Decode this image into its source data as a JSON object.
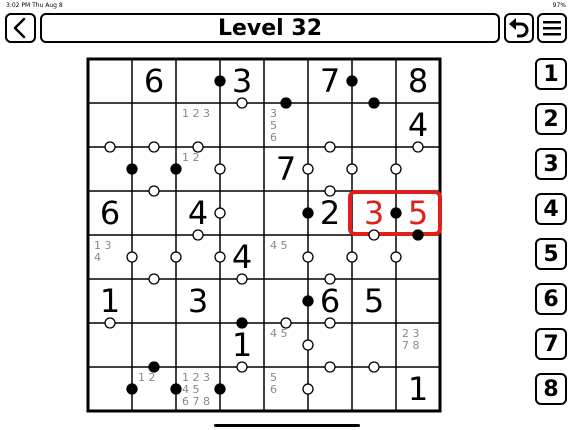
{
  "status_bar": {
    "time": "3:02 PM  Thu Aug 8",
    "battery": "97%"
  },
  "header": {
    "title": "Level 32"
  },
  "icons": {
    "back": "chevron-left-icon",
    "undo": "undo-icon",
    "menu": "hamburger-menu-icon"
  },
  "number_pad": [
    "1",
    "2",
    "3",
    "4",
    "5",
    "6",
    "7",
    "8"
  ],
  "colors": {
    "highlight": "#e0201c",
    "grid": "#000000",
    "pencil": "#888888"
  },
  "grid": {
    "size": 8,
    "givens": [
      {
        "r": 0,
        "c": 1,
        "v": "6"
      },
      {
        "r": 0,
        "c": 3,
        "v": "3"
      },
      {
        "r": 0,
        "c": 5,
        "v": "7"
      },
      {
        "r": 0,
        "c": 7,
        "v": "8"
      },
      {
        "r": 1,
        "c": 7,
        "v": "4"
      },
      {
        "r": 2,
        "c": 4,
        "v": "7"
      },
      {
        "r": 3,
        "c": 0,
        "v": "6"
      },
      {
        "r": 3,
        "c": 2,
        "v": "4"
      },
      {
        "r": 3,
        "c": 5,
        "v": "2"
      },
      {
        "r": 4,
        "c": 3,
        "v": "4"
      },
      {
        "r": 5,
        "c": 0,
        "v": "1"
      },
      {
        "r": 5,
        "c": 2,
        "v": "3"
      },
      {
        "r": 5,
        "c": 5,
        "v": "6"
      },
      {
        "r": 5,
        "c": 6,
        "v": "5"
      },
      {
        "r": 6,
        "c": 3,
        "v": "1"
      },
      {
        "r": 7,
        "c": 7,
        "v": "1"
      }
    ],
    "entered": [
      {
        "r": 3,
        "c": 6,
        "v": "3"
      },
      {
        "r": 3,
        "c": 7,
        "v": "5"
      }
    ],
    "pencil_marks": [
      {
        "r": 1,
        "c": 2,
        "v": "1 2 3"
      },
      {
        "r": 1,
        "c": 4,
        "v": "3"
      },
      {
        "r": 1,
        "c": 4,
        "v": "5"
      },
      {
        "r": 1,
        "c": 4,
        "v": "6"
      },
      {
        "r": 2,
        "c": 2,
        "v": "1 2"
      },
      {
        "r": 4,
        "c": 0,
        "v": "1   3"
      },
      {
        "r": 4,
        "c": 0,
        "v": "4"
      },
      {
        "r": 4,
        "c": 4,
        "v": "4 5"
      },
      {
        "r": 6,
        "c": 4,
        "v": "4 5"
      },
      {
        "r": 6,
        "c": 7,
        "v": "2 3"
      },
      {
        "r": 6,
        "c": 7,
        "v": "7 8"
      },
      {
        "r": 7,
        "c": 1,
        "v": "1 2"
      },
      {
        "r": 7,
        "c": 2,
        "v": "1 2 3"
      },
      {
        "r": 7,
        "c": 2,
        "v": "4 5"
      },
      {
        "r": 7,
        "c": 2,
        "v": "6 7 8"
      },
      {
        "r": 7,
        "c": 4,
        "v": "5"
      },
      {
        "r": 7,
        "c": 4,
        "v": "6"
      }
    ],
    "dots": {
      "vertical": [
        {
          "r": 0,
          "c": 2,
          "t": "b"
        },
        {
          "r": 0,
          "c": 5,
          "t": "b"
        },
        {
          "r": 3,
          "c": 2,
          "t": "w"
        },
        {
          "r": 3,
          "c": 4,
          "t": "b"
        },
        {
          "r": 3,
          "c": 6,
          "t": "b"
        },
        {
          "r": 4,
          "c": 0,
          "t": "w"
        },
        {
          "r": 4,
          "c": 1,
          "t": "w"
        },
        {
          "r": 4,
          "c": 2,
          "t": "w"
        },
        {
          "r": 4,
          "c": 4,
          "t": "w"
        },
        {
          "r": 4,
          "c": 5,
          "t": "w"
        },
        {
          "r": 4,
          "c": 6,
          "t": "w"
        },
        {
          "r": 2,
          "c": 0,
          "t": "b"
        },
        {
          "r": 2,
          "c": 1,
          "t": "b"
        },
        {
          "r": 2,
          "c": 2,
          "t": "w"
        },
        {
          "r": 2,
          "c": 4,
          "t": "w"
        },
        {
          "r": 2,
          "c": 5,
          "t": "w"
        },
        {
          "r": 2,
          "c": 6,
          "t": "w"
        },
        {
          "r": 5,
          "c": 4,
          "t": "b"
        },
        {
          "r": 6,
          "c": 4,
          "t": "w"
        },
        {
          "r": 7,
          "c": 0,
          "t": "b"
        },
        {
          "r": 7,
          "c": 1,
          "t": "b"
        },
        {
          "r": 7,
          "c": 2,
          "t": "b"
        },
        {
          "r": 7,
          "c": 4,
          "t": "w"
        }
      ],
      "horizontal": [
        {
          "r": 0,
          "c": 3,
          "t": "w"
        },
        {
          "r": 0,
          "c": 4,
          "t": "b"
        },
        {
          "r": 0,
          "c": 6,
          "t": "b"
        },
        {
          "r": 1,
          "c": 0,
          "t": "w"
        },
        {
          "r": 1,
          "c": 1,
          "t": "w"
        },
        {
          "r": 1,
          "c": 2,
          "t": "w"
        },
        {
          "r": 1,
          "c": 5,
          "t": "w"
        },
        {
          "r": 1,
          "c": 7,
          "t": "w"
        },
        {
          "r": 2,
          "c": 1,
          "t": "w"
        },
        {
          "r": 2,
          "c": 5,
          "t": "w"
        },
        {
          "r": 3,
          "c": 2,
          "t": "w"
        },
        {
          "r": 3,
          "c": 6,
          "t": "w"
        },
        {
          "r": 3,
          "c": 7,
          "t": "b"
        },
        {
          "r": 4,
          "c": 1,
          "t": "w"
        },
        {
          "r": 4,
          "c": 3,
          "t": "w"
        },
        {
          "r": 4,
          "c": 5,
          "t": "w"
        },
        {
          "r": 5,
          "c": 0,
          "t": "w"
        },
        {
          "r": 5,
          "c": 3,
          "t": "b"
        },
        {
          "r": 5,
          "c": 4,
          "t": "w"
        },
        {
          "r": 5,
          "c": 5,
          "t": "w"
        },
        {
          "r": 6,
          "c": 1,
          "t": "b"
        },
        {
          "r": 6,
          "c": 3,
          "t": "w"
        },
        {
          "r": 6,
          "c": 5,
          "t": "w"
        },
        {
          "r": 6,
          "c": 6,
          "t": "w"
        }
      ]
    }
  }
}
